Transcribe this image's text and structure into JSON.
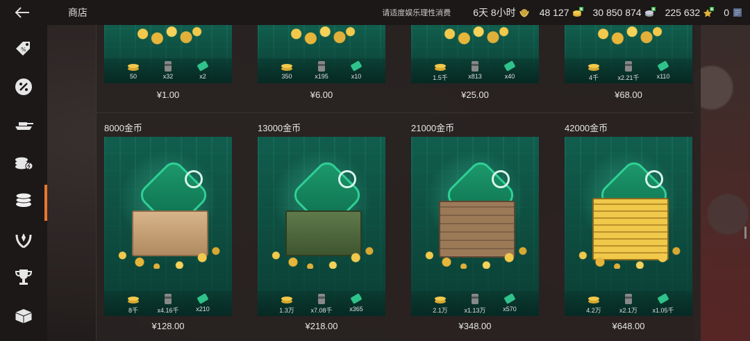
{
  "topbar": {
    "back_icon": "back-arrow-icon",
    "title": "商店",
    "notice": "请适度娱乐理性消费",
    "premium_time": "6天 8小时",
    "credits_gold": "48 127",
    "silver": "30 850 874",
    "free_xp": "225 632",
    "other": "0"
  },
  "sidebar": {
    "items": [
      {
        "name": "sidebar-item-discount-tags",
        "icon": "tag-icon"
      },
      {
        "name": "sidebar-item-sale",
        "icon": "percent-badge-icon"
      },
      {
        "name": "sidebar-item-vehicles",
        "icon": "tank-icon"
      },
      {
        "name": "sidebar-item-currency-exchange",
        "icon": "coin-stack-bolt-icon"
      },
      {
        "name": "sidebar-item-gold",
        "icon": "coin-stack-icon",
        "active": true
      },
      {
        "name": "sidebar-item-premium",
        "icon": "wreath-icon"
      },
      {
        "name": "sidebar-item-achievements",
        "icon": "trophy-icon"
      },
      {
        "name": "sidebar-item-containers",
        "icon": "crate-icon"
      }
    ]
  },
  "top_row": [
    {
      "rewards": [
        "50",
        "x32",
        "x2"
      ],
      "price": "¥1.00"
    },
    {
      "rewards": [
        "350",
        "x195",
        "x10"
      ],
      "price": "¥6.00"
    },
    {
      "rewards": [
        "1.5千",
        "x813",
        "x40"
      ],
      "price": "¥25.00"
    },
    {
      "rewards": [
        "4千",
        "x2.21千",
        "x110"
      ],
      "price": "¥68.00"
    }
  ],
  "bottom_row": [
    {
      "title": "8000金币",
      "rewards": [
        "8千",
        "x4.16千",
        "x210"
      ],
      "price": "¥128.00",
      "box": "wooden-box"
    },
    {
      "title": "13000金币",
      "rewards": [
        "1.3万",
        "x7.08千",
        "x365"
      ],
      "price": "¥218.00",
      "box": "military-crate"
    },
    {
      "title": "21000金币",
      "rewards": [
        "2.1万",
        "x1.13万",
        "x570"
      ],
      "price": "¥348.00",
      "box": "stacked-crates"
    },
    {
      "title": "42000金币",
      "rewards": [
        "4.2万",
        "x2.1万",
        "x1.05千"
      ],
      "price": "¥648.00",
      "box": "gold-bars"
    }
  ],
  "colors": {
    "accent": "#e8772a",
    "card_teal": "#0e4a3e",
    "gold": "#f2c94c"
  }
}
